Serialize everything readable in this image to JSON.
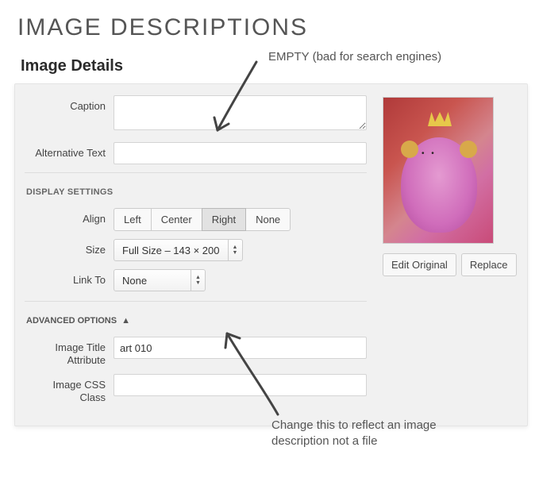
{
  "page_title": "IMAGE DESCRIPTIONS",
  "panel_title": "Image Details",
  "annotations": {
    "empty": "EMPTY (bad for search engines)",
    "change": "Change this to reflect an image description not a file"
  },
  "fields": {
    "caption": {
      "label": "Caption",
      "value": ""
    },
    "alt_text": {
      "label": "Alternative Text",
      "value": ""
    }
  },
  "display_settings": {
    "heading": "DISPLAY SETTINGS",
    "align": {
      "label": "Align",
      "options": [
        "Left",
        "Center",
        "Right",
        "None"
      ],
      "selected": "Right"
    },
    "size": {
      "label": "Size",
      "value": "Full Size – 143 × 200"
    },
    "link_to": {
      "label": "Link To",
      "value": "None"
    }
  },
  "advanced": {
    "heading": "ADVANCED OPTIONS",
    "title_attr": {
      "label": "Image Title Attribute",
      "value": "art 010"
    },
    "css_class": {
      "label": "Image CSS Class",
      "value": ""
    }
  },
  "preview": {
    "edit_label": "Edit Original",
    "replace_label": "Replace"
  }
}
